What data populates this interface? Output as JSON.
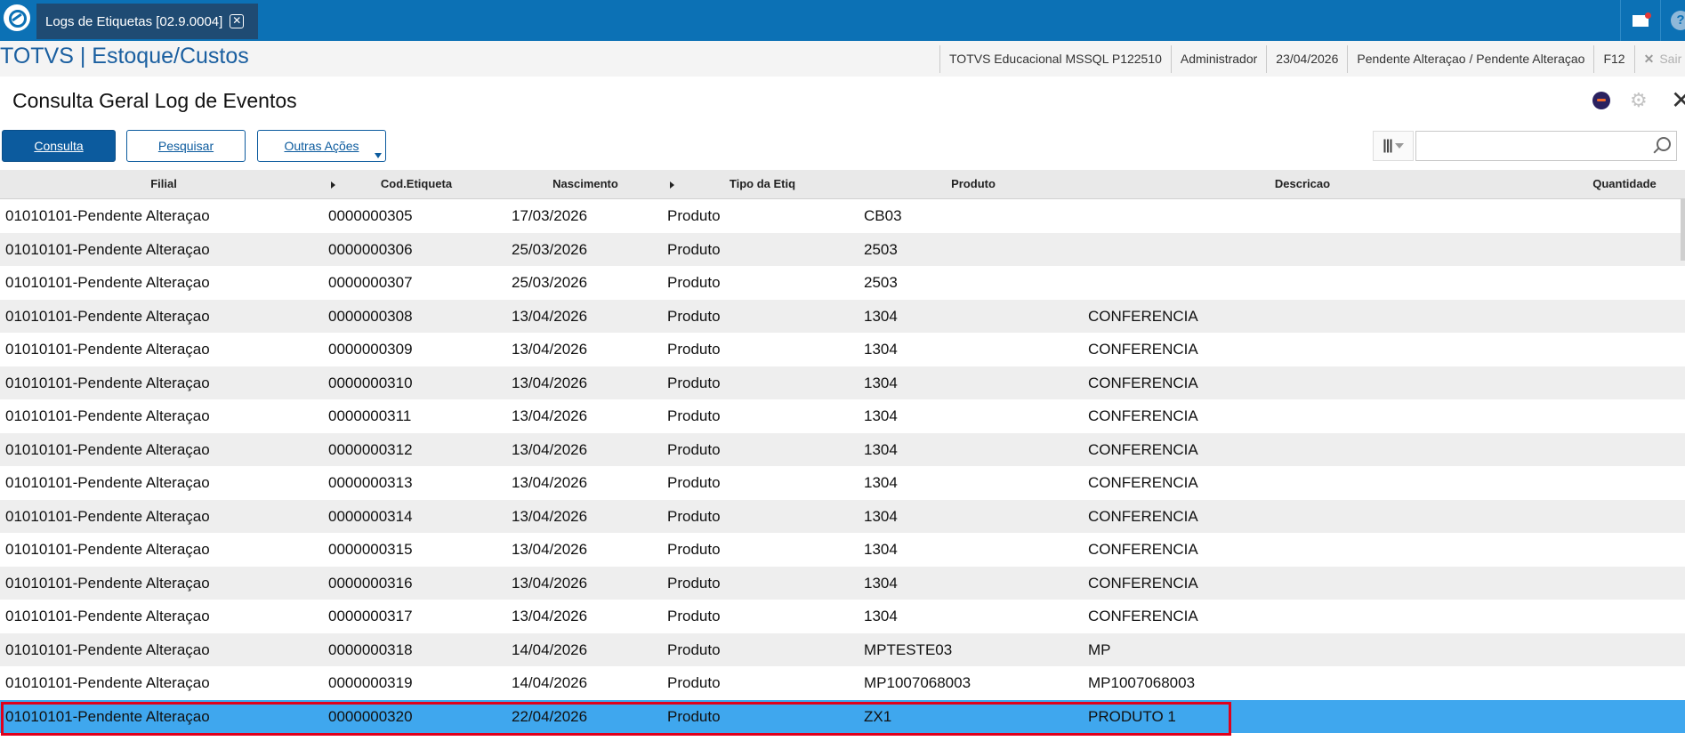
{
  "topbar": {
    "tab_title": "Logs de Etiquetas [02.9.0004]",
    "tab_close": "✕"
  },
  "header": {
    "brand": "TOTVS | Estoque/Custos",
    "environment": "TOTVS Educacional MSSQL P122510",
    "user": "Administrador",
    "date": "23/04/2026",
    "branch": "Pendente Alteraçao / Pendente Alteraçao",
    "shortcut": "F12",
    "exit": "Sair"
  },
  "page": {
    "title": "Consulta Geral Log de Eventos"
  },
  "toolbar": {
    "consulta": "Consulta",
    "pesquisar": "Pesquisar",
    "outras_acoes": "Outras Ações",
    "search_value": ""
  },
  "table": {
    "columns": {
      "filial": "Filial",
      "cod": "Cod.Etiqueta",
      "nascimento": "Nascimento",
      "tipo": "Tipo da Etiq",
      "produto": "Produto",
      "descricao": "Descricao",
      "quantidade": "Quantidade"
    },
    "rows": [
      {
        "filial": "01010101-Pendente Alteraçao",
        "cod": "0000000305",
        "nascimento": "17/03/2026",
        "tipo": "Produto",
        "produto": "CB03",
        "descricao": ""
      },
      {
        "filial": "01010101-Pendente Alteraçao",
        "cod": "0000000306",
        "nascimento": "25/03/2026",
        "tipo": "Produto",
        "produto": "2503",
        "descricao": ""
      },
      {
        "filial": "01010101-Pendente Alteraçao",
        "cod": "0000000307",
        "nascimento": "25/03/2026",
        "tipo": "Produto",
        "produto": "2503",
        "descricao": ""
      },
      {
        "filial": "01010101-Pendente Alteraçao",
        "cod": "0000000308",
        "nascimento": "13/04/2026",
        "tipo": "Produto",
        "produto": "1304",
        "descricao": "CONFERENCIA"
      },
      {
        "filial": "01010101-Pendente Alteraçao",
        "cod": "0000000309",
        "nascimento": "13/04/2026",
        "tipo": "Produto",
        "produto": "1304",
        "descricao": "CONFERENCIA"
      },
      {
        "filial": "01010101-Pendente Alteraçao",
        "cod": "0000000310",
        "nascimento": "13/04/2026",
        "tipo": "Produto",
        "produto": "1304",
        "descricao": "CONFERENCIA"
      },
      {
        "filial": "01010101-Pendente Alteraçao",
        "cod": "0000000311",
        "nascimento": "13/04/2026",
        "tipo": "Produto",
        "produto": "1304",
        "descricao": "CONFERENCIA"
      },
      {
        "filial": "01010101-Pendente Alteraçao",
        "cod": "0000000312",
        "nascimento": "13/04/2026",
        "tipo": "Produto",
        "produto": "1304",
        "descricao": "CONFERENCIA"
      },
      {
        "filial": "01010101-Pendente Alteraçao",
        "cod": "0000000313",
        "nascimento": "13/04/2026",
        "tipo": "Produto",
        "produto": "1304",
        "descricao": "CONFERENCIA"
      },
      {
        "filial": "01010101-Pendente Alteraçao",
        "cod": "0000000314",
        "nascimento": "13/04/2026",
        "tipo": "Produto",
        "produto": "1304",
        "descricao": "CONFERENCIA"
      },
      {
        "filial": "01010101-Pendente Alteraçao",
        "cod": "0000000315",
        "nascimento": "13/04/2026",
        "tipo": "Produto",
        "produto": "1304",
        "descricao": "CONFERENCIA"
      },
      {
        "filial": "01010101-Pendente Alteraçao",
        "cod": "0000000316",
        "nascimento": "13/04/2026",
        "tipo": "Produto",
        "produto": "1304",
        "descricao": "CONFERENCIA"
      },
      {
        "filial": "01010101-Pendente Alteraçao",
        "cod": "0000000317",
        "nascimento": "13/04/2026",
        "tipo": "Produto",
        "produto": "1304",
        "descricao": "CONFERENCIA"
      },
      {
        "filial": "01010101-Pendente Alteraçao",
        "cod": "0000000318",
        "nascimento": "14/04/2026",
        "tipo": "Produto",
        "produto": "MPTESTE03",
        "descricao": "MP"
      },
      {
        "filial": "01010101-Pendente Alteraçao",
        "cod": "0000000319",
        "nascimento": "14/04/2026",
        "tipo": "Produto",
        "produto": "MP1007068003",
        "descricao": "MP1007068003"
      },
      {
        "filial": "01010101-Pendente Alteraçao",
        "cod": "0000000320",
        "nascimento": "22/04/2026",
        "tipo": "Produto",
        "produto": "ZX1",
        "descricao": "PRODUTO 1"
      }
    ]
  },
  "colors": {
    "topbar": "#0c71b5",
    "selected_row": "#3fa7ee",
    "highlight": "#e0001b"
  }
}
